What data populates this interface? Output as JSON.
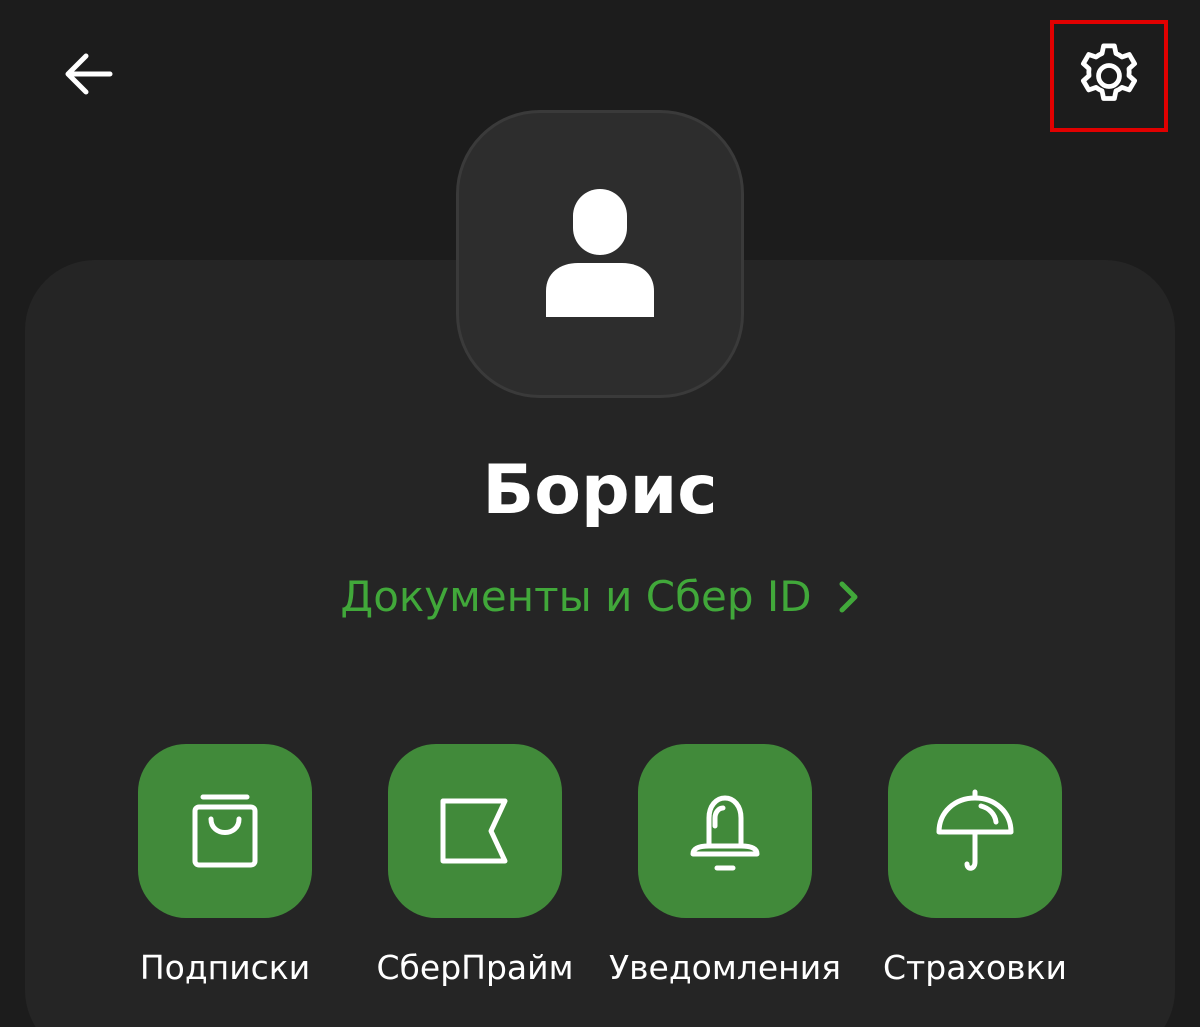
{
  "header": {
    "back_icon": "arrow-left-icon",
    "settings_icon": "gear-icon",
    "highlight_color": "#e10000"
  },
  "profile": {
    "avatar_icon": "user-silhouette-icon",
    "name": "Борис",
    "docs_link": {
      "label": "Документы и Сбер ID",
      "icon": "chevron-right-icon",
      "color": "#41a83a"
    }
  },
  "actions": [
    {
      "label": "Подписки",
      "icon": "shopping-bag-icon"
    },
    {
      "label": "СберПрайм",
      "icon": "flag-icon"
    },
    {
      "label": "Уведомления",
      "icon": "bell-icon"
    },
    {
      "label": "Страховки",
      "icon": "umbrella-icon"
    }
  ],
  "colors": {
    "background": "#1c1c1c",
    "card": "#252525",
    "avatar_tile": "#2d2d2d",
    "action_tile": "#418a3a",
    "text_primary": "#ffffff"
  }
}
